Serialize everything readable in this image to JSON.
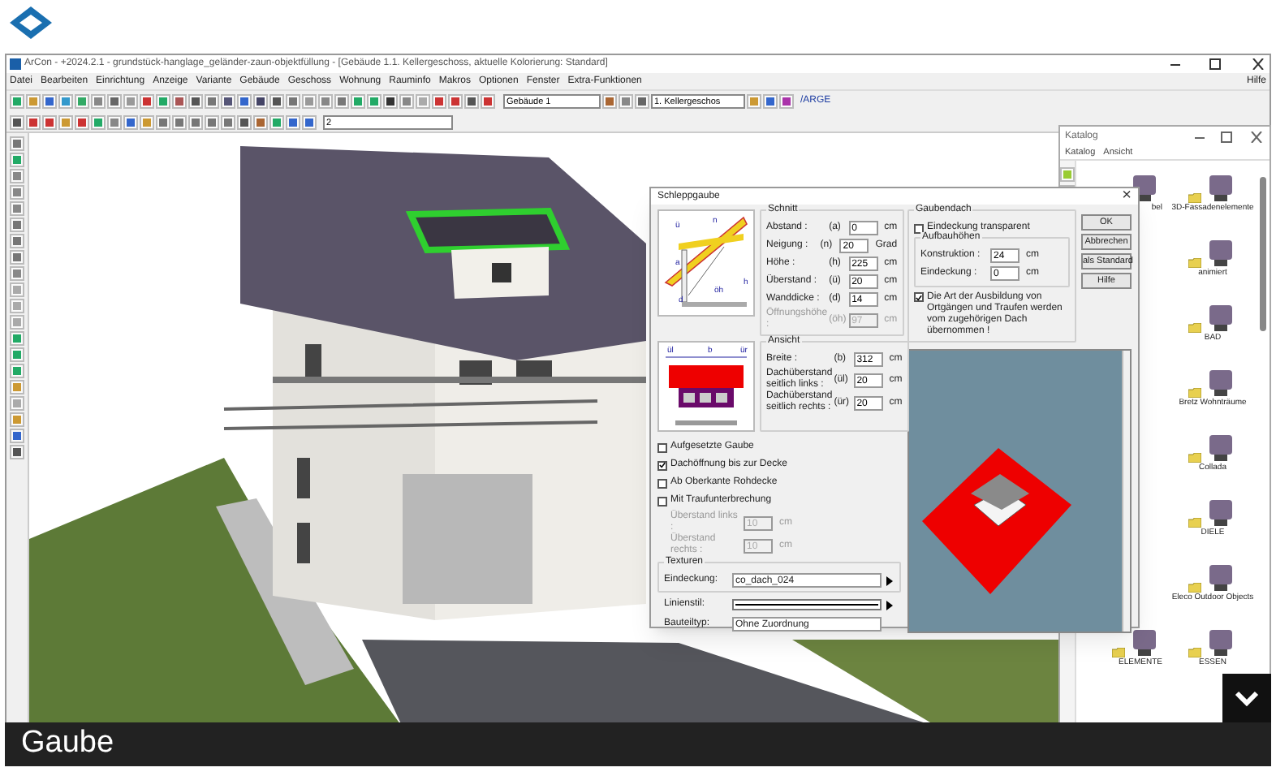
{
  "app": {
    "title": "ArCon - +2024.2.1 - grundstück-hanglage_geländer-zaun-objektfüllung - [Gebäude 1.1. Kellergeschoss, aktuelle Kolorierung: Standard]",
    "menu": [
      "Datei",
      "Bearbeiten",
      "Einrichtung",
      "Anzeige",
      "Variante",
      "Gebäude",
      "Geschoss",
      "Wohnung",
      "Rauminfo",
      "Makros",
      "Optionen",
      "Fenster",
      "Extra-Funktionen"
    ],
    "help": "Hilfe",
    "building_select": "Gebäude 1",
    "floor_select": "1. Kellergeschos",
    "arge_label": "/ARGE",
    "zoom_select": "2"
  },
  "dialog": {
    "title": "Schleppgaube",
    "close": "×",
    "section_labels": [
      "ü",
      "n",
      "a",
      "h",
      "d",
      "öh"
    ],
    "schnitt": {
      "title": "Schnitt",
      "fields": [
        {
          "label": "Abstand :",
          "code": "(a)",
          "value": "0",
          "unit": "cm",
          "disabled": false
        },
        {
          "label": "Neigung :",
          "code": "(n)",
          "value": "20",
          "unit": "Grad",
          "disabled": false
        },
        {
          "label": "Höhe :",
          "code": "(h)",
          "value": "225",
          "unit": "cm",
          "disabled": false
        },
        {
          "label": "Überstand :",
          "code": "(ü)",
          "value": "20",
          "unit": "cm",
          "disabled": false
        },
        {
          "label": "Wanddicke :",
          "code": "(d)",
          "value": "14",
          "unit": "cm",
          "disabled": false
        },
        {
          "label": "Öffnungshöhe :",
          "code": "(öh)",
          "value": "97",
          "unit": "cm",
          "disabled": true
        }
      ]
    },
    "view_labels": [
      "ül",
      "b",
      "ür"
    ],
    "ansicht": {
      "title": "Ansicht",
      "fields": [
        {
          "label": "Breite :",
          "code": "(b)",
          "value": "312",
          "unit": "cm",
          "disabled": false
        },
        {
          "label": "Dachüberstand seitlich links :",
          "code": "(ül)",
          "value": "20",
          "unit": "cm",
          "disabled": false
        },
        {
          "label": "Dachüberstand seitlich rechts :",
          "code": "(ür)",
          "value": "20",
          "unit": "cm",
          "disabled": false
        }
      ]
    },
    "options": [
      {
        "label": "Aufgesetzte Gaube",
        "checked": false
      },
      {
        "label": "Dachöffnung bis zur Decke",
        "checked": true
      },
      {
        "label": "Ab Oberkante Rohdecke",
        "checked": false
      },
      {
        "label": "Mit Traufunterbrechung",
        "checked": false
      }
    ],
    "overhangs": [
      {
        "label": "Überstand links :",
        "value": "10",
        "unit": "cm",
        "disabled": true
      },
      {
        "label": "Überstand rechts :",
        "value": "10",
        "unit": "cm",
        "disabled": true
      }
    ],
    "texturen": {
      "title": "Texturen",
      "label": "Eindeckung:",
      "value": "co_dach_024"
    },
    "linienstil": {
      "label": "Linienstil:"
    },
    "bauteiltyp": {
      "label": "Bauteiltyp:",
      "value": "Ohne Zuordnung"
    },
    "gaubendach": {
      "title": "Gaubendach",
      "transparent": {
        "label": "Eindeckung transparent",
        "checked": false
      },
      "aufbau_title": "Aufbauhöhen",
      "aufbau": [
        {
          "label": "Konstruktion :",
          "value": "24",
          "unit": "cm"
        },
        {
          "label": "Eindeckung :",
          "value": "0",
          "unit": "cm"
        }
      ],
      "inherit": {
        "label": "Die Art der Ausbildung von Ortgängen und Traufen werden vom zugehörigen Dach übernommen !",
        "checked": true
      }
    },
    "buttons": [
      "OK",
      "Abbrechen",
      "als Standard",
      "Hilfe"
    ]
  },
  "catalog": {
    "title": "Katalog",
    "menu": [
      "Katalog",
      "Ansicht"
    ],
    "rows": [
      {
        "left": "bel",
        "right": "3D-Fassadenelemente"
      },
      {
        "right": "animiert"
      },
      {
        "right": "BAD"
      },
      {
        "right": "Bretz Wohnträume"
      },
      {
        "right": "Collada"
      },
      {
        "right": "DIELE"
      },
      {
        "right": "Eleco Outdoor Objects"
      },
      {
        "left": "ELEMENTE",
        "right": "ESSEN"
      }
    ]
  },
  "caption": "Gaube"
}
